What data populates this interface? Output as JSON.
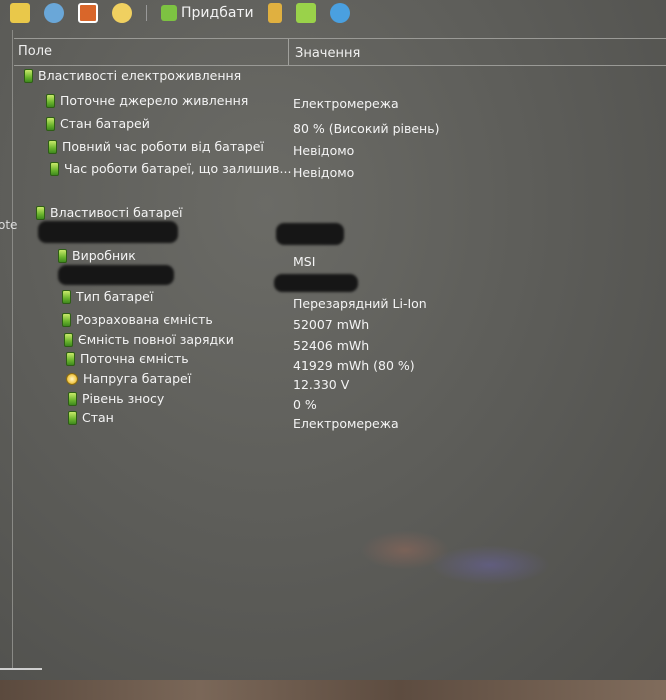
{
  "toolbar": {
    "add_label": "Придбати",
    "icons": [
      "folder-icon",
      "users-icon",
      "osd-icon",
      "disc-icon",
      "add-icon",
      "tools-icon",
      "download-icon",
      "search-icon"
    ]
  },
  "left_panel": {
    "partial_text": "ote"
  },
  "table": {
    "headers": {
      "field": "Поле",
      "value": "Значення"
    },
    "power_section": {
      "title": "Властивості електроживлення",
      "rows": [
        {
          "label": "Поточне джерело живлення",
          "value": "Електромережа"
        },
        {
          "label": "Стан батарей",
          "value": "80 % (Високий рівень)"
        },
        {
          "label": "Повний час роботи від батареї",
          "value": "Невідомо"
        },
        {
          "label": "Час роботи батареї, що залишив...",
          "value": "Невідомо"
        }
      ]
    },
    "battery_section": {
      "title": "Властивості батареї",
      "rows": [
        {
          "label": "Виробник",
          "value": "MSI"
        },
        {
          "label": "Тип батареї",
          "value": "Перезарядний Li-Ion"
        },
        {
          "label": "Розрахована ємність",
          "value": "52007 mWh"
        },
        {
          "label": "Ємність повної зарядки",
          "value": "52406 mWh"
        },
        {
          "label": "Поточна ємність",
          "value": "41929 mWh  (80 %)"
        },
        {
          "label": "Напруга батареї",
          "value": "12.330 V"
        },
        {
          "label": "Рівень зносу",
          "value": "0 %"
        },
        {
          "label": "Стан",
          "value": "Електромережа"
        }
      ]
    }
  }
}
